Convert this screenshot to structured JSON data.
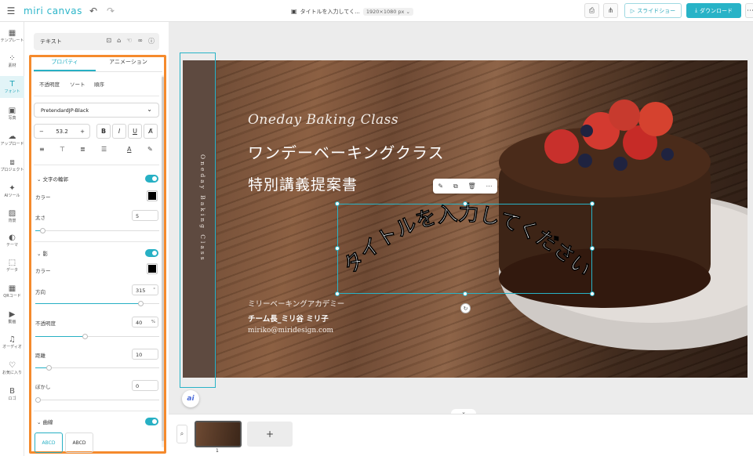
{
  "topbar": {
    "logo": "miri canvas",
    "title": "タイトルを入力してく...",
    "size": "1920×1080 px",
    "slideshow_label": "スライドショー",
    "download_label": "ダウンロード"
  },
  "rail": {
    "items": [
      {
        "icon": "template-icon",
        "label": "テンプレート"
      },
      {
        "icon": "elements-icon",
        "label": "素材"
      },
      {
        "icon": "font-icon",
        "label": "フォント"
      },
      {
        "icon": "photo-icon",
        "label": "写真"
      },
      {
        "icon": "upload-icon",
        "label": "アップロード"
      },
      {
        "icon": "project-icon",
        "label": "プロジェクト"
      },
      {
        "icon": "ai-tool-icon",
        "label": "AIツール"
      },
      {
        "icon": "background-icon",
        "label": "背景"
      },
      {
        "icon": "theme-icon",
        "label": "テーマ"
      },
      {
        "icon": "data-icon",
        "label": "データ"
      },
      {
        "icon": "qr-icon",
        "label": "QRコード"
      },
      {
        "icon": "video-icon",
        "label": "動画"
      },
      {
        "icon": "audio-icon",
        "label": "オーディオ"
      },
      {
        "icon": "favorite-icon",
        "label": "お気に入り"
      },
      {
        "icon": "brand-icon",
        "label": "ロゴ"
      }
    ]
  },
  "panel": {
    "element_type": "テキスト",
    "tabs": [
      "プロパティ",
      "アニメーション"
    ],
    "subtabs": [
      "不透明度",
      "ソート",
      "順序"
    ],
    "font_name": "PretendardJP-Black",
    "font_size": "53.2",
    "outline": {
      "title": "文字の輪郭",
      "color_label": "カラー",
      "width_label": "太さ",
      "width_value": "5"
    },
    "shadow": {
      "title": "影",
      "color_label": "カラー",
      "direction_label": "方向",
      "direction_value": "315",
      "direction_unit": "°",
      "opacity_label": "不透明度",
      "opacity_value": "40",
      "opacity_unit": "%",
      "distance_label": "距離",
      "distance_value": "10",
      "blur_label": "ぼかし",
      "blur_value": "0"
    },
    "curve": {
      "title": "曲線",
      "opt1": "ABCD",
      "opt2": "ABCD"
    }
  },
  "slide": {
    "vertical_text": "Oneday Baking Class",
    "script_title": "Oneday Baking Class",
    "title_line1": "ワンデーベーキングクラス",
    "title_line2": "特別講義提案書",
    "curved_text": "タイトルを入力してください",
    "footer_line1": "ミリーベーキングアカデミー",
    "footer_line2": "チーム長_ミリ谷 ミリ子",
    "footer_line3": "miriko@miridesign.com"
  },
  "filmstrip": {
    "page_number": "1",
    "add_label": "+"
  },
  "colors": {
    "accent": "#28b3c7",
    "highlight": "#f58a2c",
    "band": "#5e4a40"
  }
}
